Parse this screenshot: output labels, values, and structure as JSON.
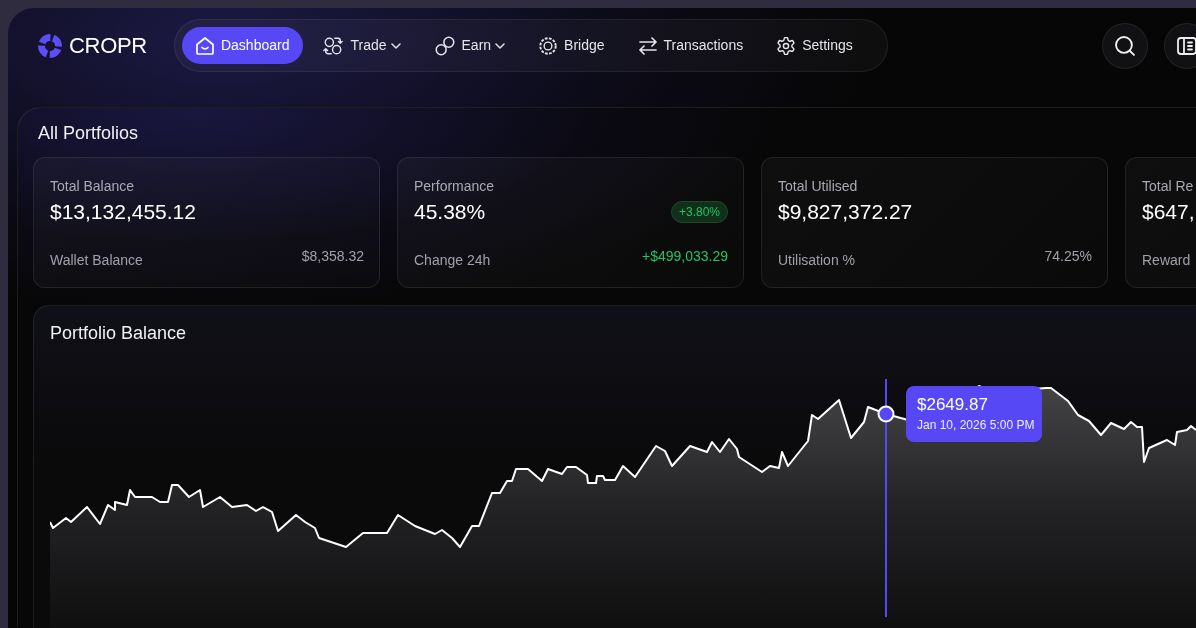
{
  "brand": {
    "name": "CROPR"
  },
  "nav": [
    {
      "label": "Dashboard",
      "kind": "link",
      "selected": true
    },
    {
      "label": "Trade",
      "kind": "menu",
      "selected": false
    },
    {
      "label": "Earn",
      "kind": "menu",
      "selected": false
    },
    {
      "label": "Bridge",
      "kind": "link",
      "selected": false
    },
    {
      "label": "Transactions",
      "kind": "link",
      "selected": false
    },
    {
      "label": "Settings",
      "kind": "link",
      "selected": false
    }
  ],
  "portfolios": {
    "title": "All Portfolios",
    "cards": [
      {
        "label": "Total Balance",
        "value": "$13,132,455.12",
        "footer_label": "Wallet Balance",
        "footer_value": "$8,358.32",
        "positive": false
      },
      {
        "label": "Performance",
        "value": "45.38%",
        "badge": "+3.80%",
        "footer_label": "Change 24h",
        "footer_value": "+$499,033.29",
        "positive": true
      },
      {
        "label": "Total Utilised",
        "value": "$9,827,372.27",
        "footer_label": "Utilisation %",
        "footer_value": "74.25%",
        "positive": false
      },
      {
        "label": "Total Re",
        "value": "$647,",
        "footer_label": "Reward"
      }
    ]
  },
  "chart": {
    "title": "Portfolio Balance",
    "tooltip": {
      "value": "$2649.87",
      "time": "Jan 10, 2026 5:00 PM"
    }
  }
}
